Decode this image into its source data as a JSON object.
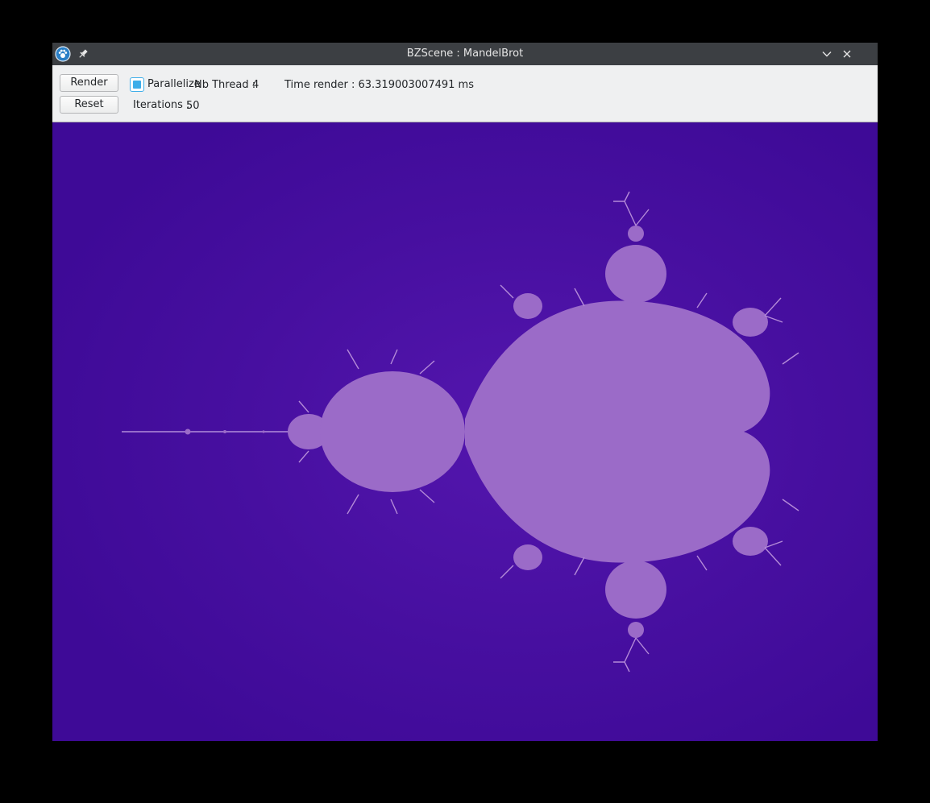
{
  "window": {
    "title": "BZScene : MandelBrot"
  },
  "toolbar": {
    "render_label": "Render",
    "reset_label": "Reset",
    "parallelize_label": "Parallelize",
    "parallelize_checked": true,
    "nb_thread_label": "Nb Thread :",
    "nb_thread_value": "4",
    "time_render_text": "Time render : 63.319003007491 ms",
    "iterations_label": "Iterations :",
    "iterations_value": "50"
  },
  "icons": {
    "app": "app-paw-icon",
    "pin": "pin-icon",
    "minimize": "chevron-down-icon",
    "close": "close-icon"
  },
  "colors": {
    "titlebar": "#3c3f43",
    "toolbar": "#eff0f1",
    "accent": "#3daee9",
    "fractal_background": "#3e0a97",
    "fractal_set": "#9b6bc8"
  }
}
